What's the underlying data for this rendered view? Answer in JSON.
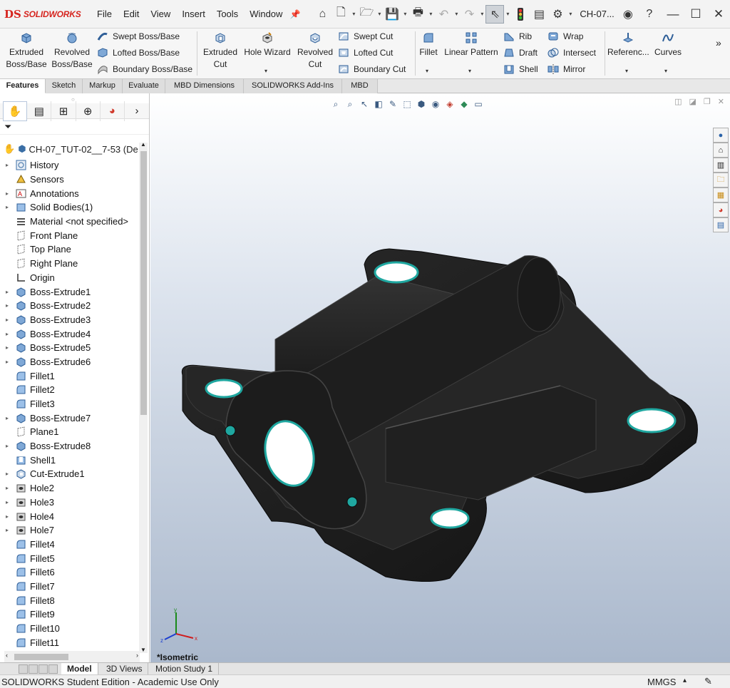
{
  "brand": {
    "mark": "DS",
    "name": "SOLIDWORKS"
  },
  "menu": [
    "File",
    "Edit",
    "View",
    "Insert",
    "Tools",
    "Window"
  ],
  "document_title": "CH-07...",
  "ribbon": {
    "extruded_boss": "Extruded Boss/Base",
    "revolved_boss": "Revolved Boss/Base",
    "swept_boss": "Swept Boss/Base",
    "lofted_boss": "Lofted Boss/Base",
    "boundary_boss": "Boundary Boss/Base",
    "extruded_cut": "Extruded Cut",
    "hole_wizard": "Hole Wizard",
    "revolved_cut": "Revolved Cut",
    "swept_cut": "Swept Cut",
    "lofted_cut": "Lofted Cut",
    "boundary_cut": "Boundary Cut",
    "fillet": "Fillet",
    "linear_pattern": "Linear Pattern",
    "rib": "Rib",
    "draft": "Draft",
    "shell": "Shell",
    "wrap": "Wrap",
    "intersect": "Intersect",
    "mirror": "Mirror",
    "reference": "Referenc...",
    "curves": "Curves",
    "more": "»"
  },
  "command_tabs": [
    "Features",
    "Sketch",
    "Markup",
    "Evaluate",
    "MBD Dimensions",
    "SOLIDWORKS Add-Ins",
    "MBD"
  ],
  "feature_tree": {
    "root": "CH-07_TUT-02__7-53  (De",
    "items": [
      {
        "label": "History",
        "expandable": true,
        "icon": "history-icon"
      },
      {
        "label": "Sensors",
        "expandable": false,
        "icon": "sensor-icon"
      },
      {
        "label": "Annotations",
        "expandable": true,
        "icon": "annotation-icon"
      },
      {
        "label": "Solid Bodies(1)",
        "expandable": true,
        "icon": "solid-bodies-icon"
      },
      {
        "label": "Material <not specified>",
        "expandable": false,
        "icon": "material-icon"
      },
      {
        "label": "Front Plane",
        "expandable": false,
        "icon": "plane-icon"
      },
      {
        "label": "Top Plane",
        "expandable": false,
        "icon": "plane-icon"
      },
      {
        "label": "Right Plane",
        "expandable": false,
        "icon": "plane-icon"
      },
      {
        "label": "Origin",
        "expandable": false,
        "icon": "origin-icon"
      },
      {
        "label": "Boss-Extrude1",
        "expandable": true,
        "icon": "extrude-icon"
      },
      {
        "label": "Boss-Extrude2",
        "expandable": true,
        "icon": "extrude-icon"
      },
      {
        "label": "Boss-Extrude3",
        "expandable": true,
        "icon": "extrude-icon"
      },
      {
        "label": "Boss-Extrude4",
        "expandable": true,
        "icon": "extrude-icon"
      },
      {
        "label": "Boss-Extrude5",
        "expandable": true,
        "icon": "extrude-icon"
      },
      {
        "label": "Boss-Extrude6",
        "expandable": true,
        "icon": "extrude-icon"
      },
      {
        "label": "Fillet1",
        "expandable": false,
        "icon": "fillet-icon"
      },
      {
        "label": "Fillet2",
        "expandable": false,
        "icon": "fillet-icon"
      },
      {
        "label": "Fillet3",
        "expandable": false,
        "icon": "fillet-icon"
      },
      {
        "label": "Boss-Extrude7",
        "expandable": true,
        "icon": "extrude-icon"
      },
      {
        "label": "Plane1",
        "expandable": false,
        "icon": "plane-icon"
      },
      {
        "label": "Boss-Extrude8",
        "expandable": true,
        "icon": "extrude-icon"
      },
      {
        "label": "Shell1",
        "expandable": false,
        "icon": "shell-icon"
      },
      {
        "label": "Cut-Extrude1",
        "expandable": true,
        "icon": "cut-extrude-icon"
      },
      {
        "label": "Hole2",
        "expandable": true,
        "icon": "hole-icon"
      },
      {
        "label": "Hole3",
        "expandable": true,
        "icon": "hole-icon"
      },
      {
        "label": "Hole4",
        "expandable": true,
        "icon": "hole-icon"
      },
      {
        "label": "Hole7",
        "expandable": true,
        "icon": "hole-icon"
      },
      {
        "label": "Fillet4",
        "expandable": false,
        "icon": "fillet-icon"
      },
      {
        "label": "Fillet5",
        "expandable": false,
        "icon": "fillet-icon"
      },
      {
        "label": "Fillet6",
        "expandable": false,
        "icon": "fillet-icon"
      },
      {
        "label": "Fillet7",
        "expandable": false,
        "icon": "fillet-icon"
      },
      {
        "label": "Fillet8",
        "expandable": false,
        "icon": "fillet-icon"
      },
      {
        "label": "Fillet9",
        "expandable": false,
        "icon": "fillet-icon"
      },
      {
        "label": "Fillet10",
        "expandable": false,
        "icon": "fillet-icon"
      },
      {
        "label": "Fillet11",
        "expandable": false,
        "icon": "fillet-icon"
      }
    ]
  },
  "graphics": {
    "view_label": "*Isometric",
    "triad": {
      "x": "x",
      "y": "y",
      "z": "z"
    }
  },
  "bottom_tabs": [
    "Model",
    "3D Views",
    "Motion Study 1"
  ],
  "status": {
    "edition": "SOLIDWORKS Student Edition - Academic Use Only",
    "units": "MMGS",
    "units_arrow": "▴"
  },
  "colors": {
    "brand": "#d6251f",
    "accent_teal": "#1fa7a0",
    "part": "#1b1b1b",
    "icon_blue": "#3a6ea5"
  }
}
